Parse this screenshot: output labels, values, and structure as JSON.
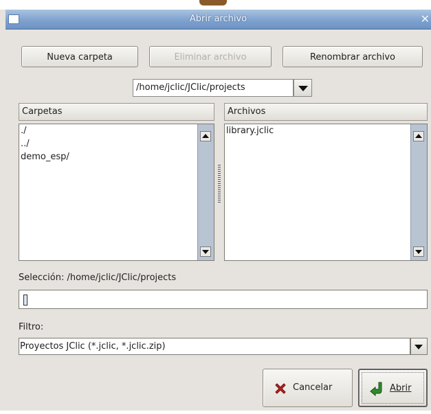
{
  "window": {
    "title": "Abrir archivo",
    "close_glyph": "✕"
  },
  "toolbar": {
    "new_folder": "Nueva carpeta",
    "delete_file": "Eliminar archivo",
    "rename_file": "Renombrar archivo"
  },
  "path": {
    "current": "/home/jclic/JClic/projects"
  },
  "folders": {
    "header": "Carpetas",
    "items": [
      "./",
      "../",
      "demo_esp/"
    ]
  },
  "files": {
    "header": "Archivos",
    "items": [
      "library.jclic"
    ]
  },
  "selection": {
    "label": "Selección: /home/jclic/JClic/projects",
    "value": ""
  },
  "filter": {
    "label": "Filtro:",
    "selected": "Proyectos JClic (*.jclic, *.jclic.zip)"
  },
  "actions": {
    "cancel": "Cancelar",
    "open": "Abrir"
  },
  "icons": {
    "cancel": "red-x-icon",
    "open": "green-arrow-icon",
    "title": "window-icon",
    "dropdown": "chevron-down-icon"
  },
  "colors": {
    "titlebar": "#7fa2cf",
    "dialog_bg": "#e6e3de",
    "scrollbar": "#b8c4d2",
    "cancel_icon": "#c0221f",
    "open_icon": "#2e8b2e"
  }
}
